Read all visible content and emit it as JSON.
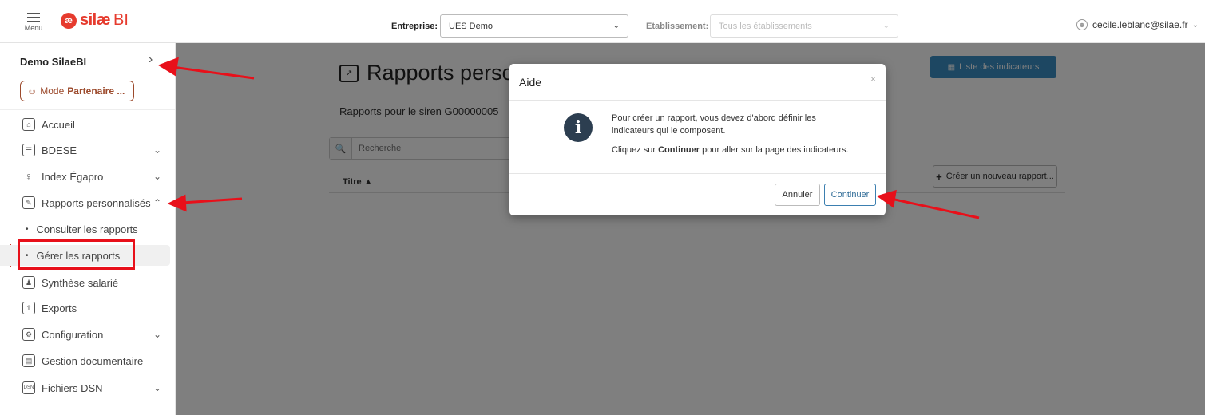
{
  "header": {
    "menu_label": "Menu",
    "logo_text": "silæ",
    "logo_suffix": "BI",
    "entreprise_label": "Entreprise:",
    "entreprise_value": "UES Demo",
    "etablissement_label": "Etablissement:",
    "etablissement_placeholder": "Tous les établissements",
    "user_email": "cecile.leblanc@silae.fr"
  },
  "sidebar": {
    "org_name": "Demo SilaeBI",
    "mode_prefix": "Mode",
    "mode_value": "Partenaire ...",
    "items": [
      {
        "label": "Accueil",
        "icon": "home-icon"
      },
      {
        "label": "BDESE",
        "icon": "database-icon"
      },
      {
        "label": "Index Égapro",
        "icon": "gender-icon"
      },
      {
        "label": "Rapports personnalisés",
        "icon": "report-edit-icon"
      },
      {
        "label": "Synthèse salarié",
        "icon": "person-badge-icon"
      },
      {
        "label": "Exports",
        "icon": "export-icon"
      },
      {
        "label": "Configuration",
        "icon": "settings-doc-icon"
      },
      {
        "label": "Gestion documentaire",
        "icon": "document-icon"
      },
      {
        "label": "Fichiers DSN",
        "icon": "dsn-file-icon"
      }
    ],
    "sub_items": [
      {
        "label": "Consulter les rapports"
      },
      {
        "label": "Gérer les rapports"
      }
    ]
  },
  "main": {
    "title": "Rapports personnalisés",
    "subtitle": "Rapports pour le siren G00000005",
    "search_placeholder": "Recherche",
    "list_button": "Liste des indicateurs",
    "create_button": "Créer un nouveau rapport...",
    "col_title": "Titre ▲"
  },
  "modal": {
    "title": "Aide",
    "line1": "Pour créer un rapport, vous devez d'abord définir les indicateurs qui le composent.",
    "line2_prefix": "Cliquez sur",
    "line2_bold": "Continuer",
    "line2_suffix": "pour aller sur la page des indicateurs.",
    "cancel": "Annuler",
    "continue": "Continuer"
  },
  "colors": {
    "brand": "#e63b2e",
    "accent": "#3b8fc4",
    "annotation": "#e8101a"
  }
}
